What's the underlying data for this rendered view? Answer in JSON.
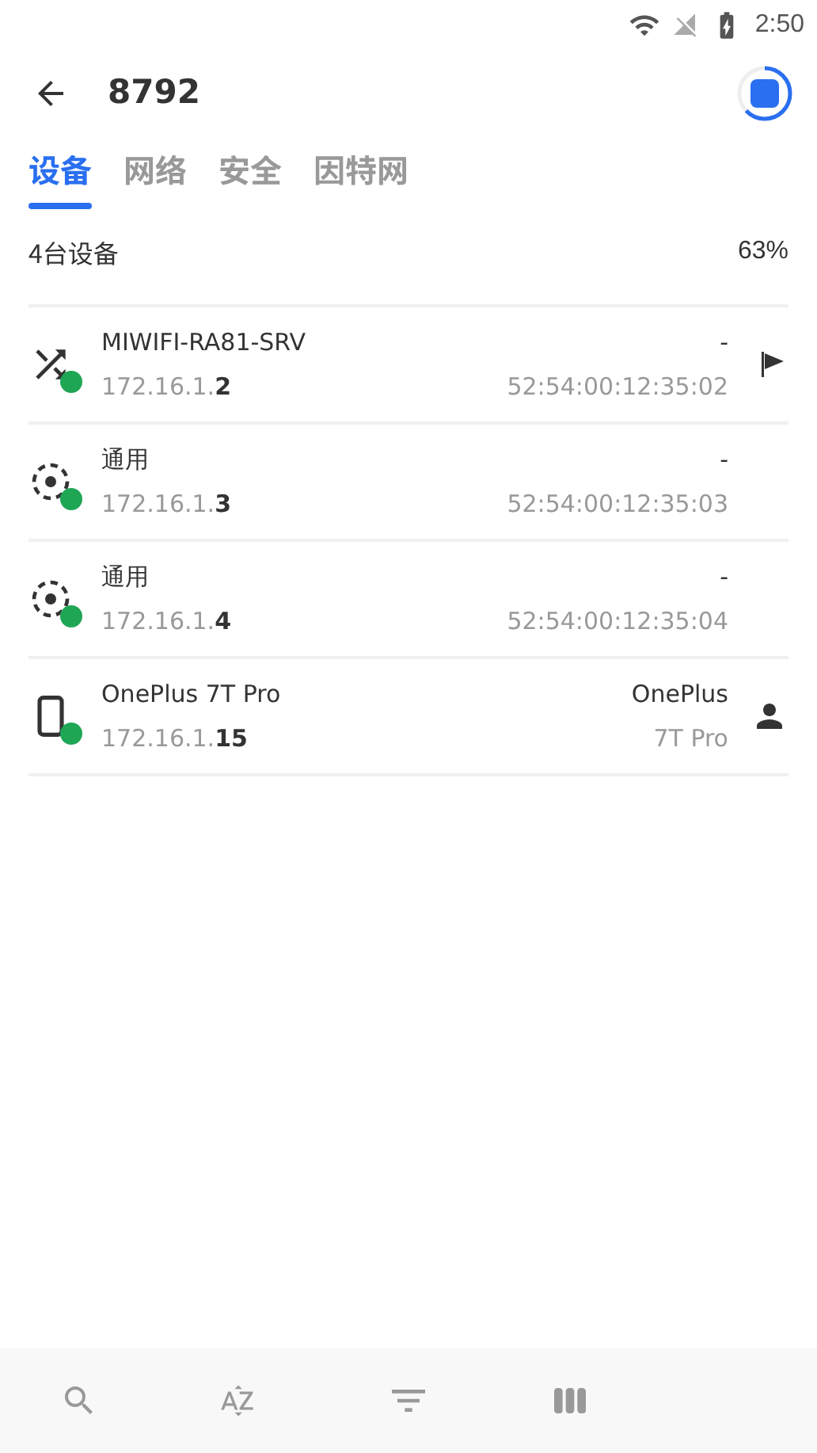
{
  "status_bar": {
    "time": "2:50"
  },
  "toolbar": {
    "title": "8792",
    "scan_progress": {
      "level": 0.63
    }
  },
  "tabs": [
    {
      "label": "设备",
      "selected": true
    },
    {
      "label": "网络",
      "selected": false
    },
    {
      "label": "安全",
      "selected": false
    },
    {
      "label": "因特网",
      "selected": false
    }
  ],
  "summary": {
    "count": "4台设备",
    "percent": "63%"
  },
  "devices": [
    {
      "kind": "router",
      "online": true,
      "name": "MIWIFI-RA81-SRV",
      "ip": "172.16.1.**2**",
      "vendor": "-",
      "detail": "52:54:00:12:35:02",
      "badge": {
        "kind": "flag"
      }
    },
    {
      "kind": "generic",
      "online": true,
      "name": "通用",
      "ip": "172.16.1.**3**",
      "vendor": "-",
      "detail": "52:54:00:12:35:03"
    },
    {
      "kind": "generic",
      "online": true,
      "name": "通用",
      "ip": "172.16.1.**4**",
      "vendor": "-",
      "detail": "52:54:00:12:35:04"
    },
    {
      "kind": "phone",
      "online": true,
      "name": "OnePlus 7T Pro",
      "ip": "172.16.1.**15**",
      "vendor": "OnePlus",
      "detail": "7T Pro",
      "badge": {
        "kind": "person"
      }
    }
  ]
}
